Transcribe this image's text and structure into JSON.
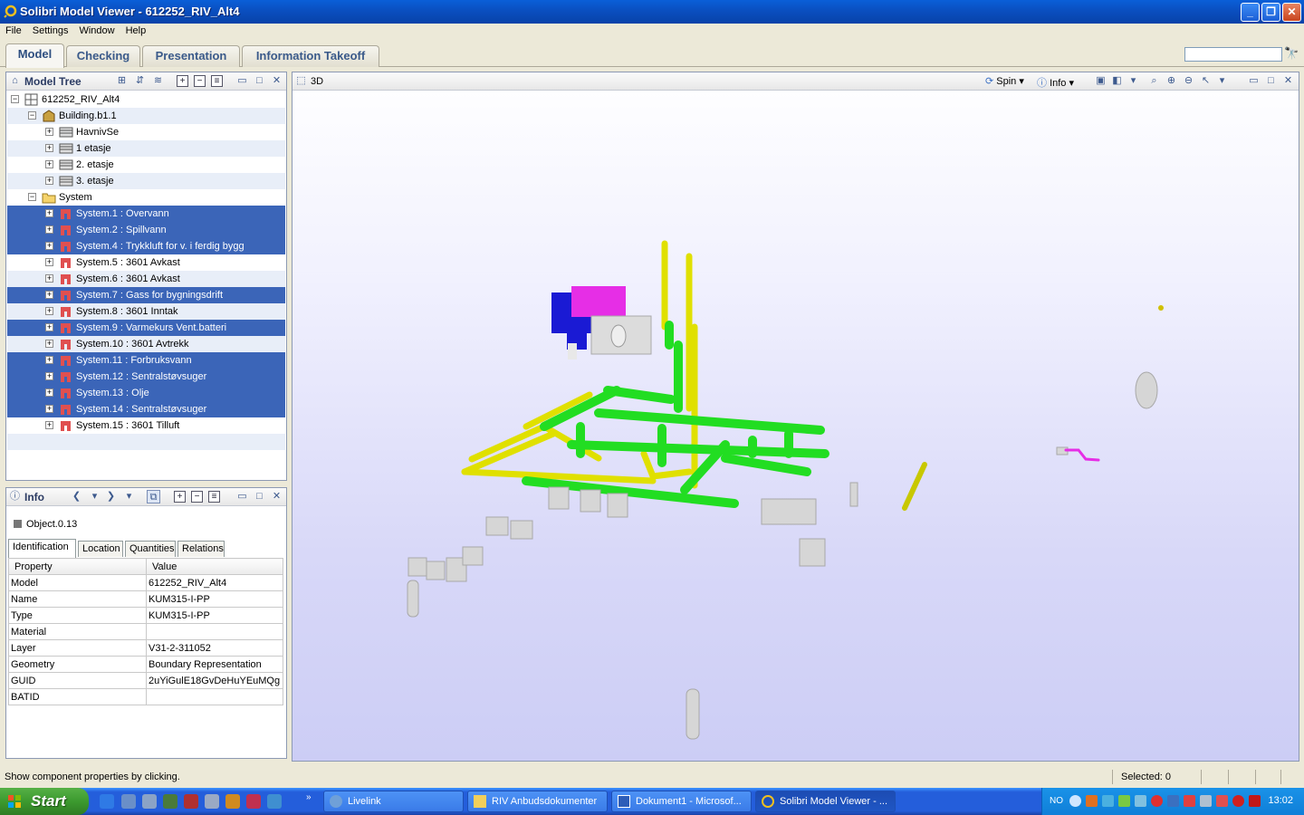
{
  "window": {
    "title": "Solibri Model Viewer - 612252_RIV_Alt4"
  },
  "menu": [
    "File",
    "Settings",
    "Window",
    "Help"
  ],
  "perspectives": [
    "Model",
    "Checking",
    "Presentation",
    "Information Takeoff"
  ],
  "search": {
    "value": ""
  },
  "model_tree": {
    "title": "Model Tree",
    "items": [
      {
        "label": "612252_RIV_Alt4"
      },
      {
        "label": "Building.b1.1"
      },
      {
        "label": "HavnivSe"
      },
      {
        "label": "1 etasje"
      },
      {
        "label": "2. etasje"
      },
      {
        "label": "3. etasje"
      },
      {
        "label": "System"
      },
      {
        "label": "System.1 : Overvann"
      },
      {
        "label": "System.2 : Spillvann"
      },
      {
        "label": "System.4 : Trykkluft for v. i ferdig bygg"
      },
      {
        "label": "System.5 : 3601 Avkast"
      },
      {
        "label": "System.6 : 3601 Avkast"
      },
      {
        "label": "System.7 : Gass for bygningsdrift"
      },
      {
        "label": "System.8 : 3601 Inntak"
      },
      {
        "label": "System.9 : Varmekurs Vent.batteri"
      },
      {
        "label": "System.10 : 3601 Avtrekk"
      },
      {
        "label": "System.11 : Forbruksvann"
      },
      {
        "label": "System.12 : Sentralstøvsuger"
      },
      {
        "label": "System.13 : Olje"
      },
      {
        "label": "System.14 : Sentralstøvsuger"
      },
      {
        "label": "System.15 : 3601 Tilluft"
      }
    ]
  },
  "info": {
    "title": "Info",
    "object": "Object.0.13",
    "tabs": [
      "Identification",
      "Location",
      "Quantities",
      "Relations"
    ],
    "columns": [
      "Property",
      "Value"
    ],
    "rows": [
      {
        "property": "Model",
        "value": "612252_RIV_Alt4"
      },
      {
        "property": "Name",
        "value": "KUM315-I-PP"
      },
      {
        "property": "Type",
        "value": "KUM315-I-PP"
      },
      {
        "property": "Material",
        "value": ""
      },
      {
        "property": "Layer",
        "value": "V31-2-311052"
      },
      {
        "property": "Geometry",
        "value": "Boundary Representation"
      },
      {
        "property": "GUID",
        "value": "2uYiGulE18GvDeHuYEuMQg"
      },
      {
        "property": "BATID",
        "value": ""
      }
    ]
  },
  "view3d": {
    "title": "3D",
    "spin_label": "Spin",
    "info_label": "Info",
    "colors": {
      "pipe_green": "#22dd22",
      "pipe_yellow": "#e6e600",
      "duct_blue": "#1a1ad4",
      "duct_magenta": "#e62ee6",
      "equipment_gray": "#d8d8d8"
    }
  },
  "status": {
    "message": "Show component properties by clicking.",
    "selected": "Selected: 0"
  },
  "taskbar": {
    "start": "Start",
    "buttons": [
      "Livelink",
      "RIV Anbudsdokumenter",
      "Dokument1 - Microsof...",
      "Solibri Model Viewer - ..."
    ],
    "lang": "NO",
    "clock": "13:02"
  }
}
